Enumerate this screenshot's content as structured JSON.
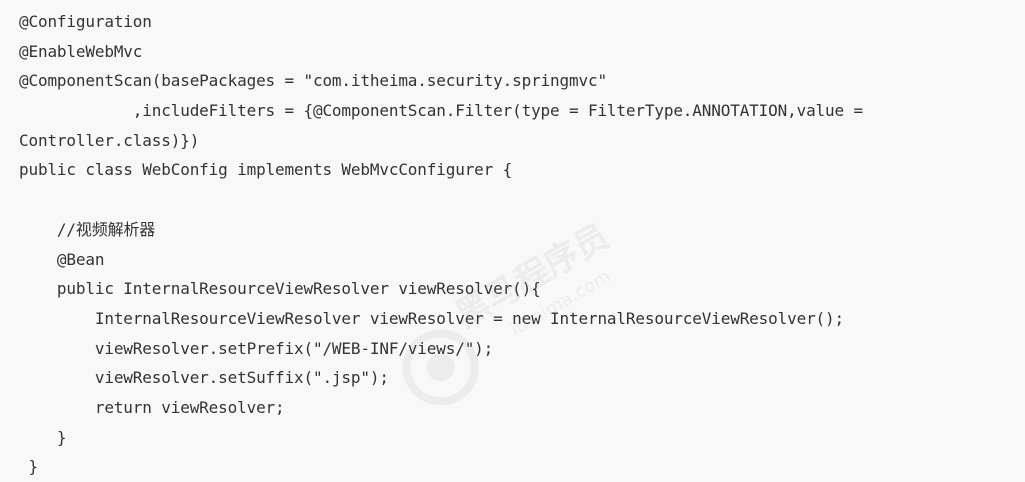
{
  "code": {
    "lines": [
      "@Configuration",
      "@EnableWebMvc",
      "@ComponentScan(basePackages = \"com.itheima.security.springmvc\"",
      "            ,includeFilters = {@ComponentScan.Filter(type = FilterType.ANNOTATION,value =",
      "Controller.class)})",
      "public class WebConfig implements WebMvcConfigurer {",
      "",
      "    //视频解析器",
      "    @Bean",
      "    public InternalResourceViewResolver viewResolver(){",
      "        InternalResourceViewResolver viewResolver = new InternalResourceViewResolver();",
      "        viewResolver.setPrefix(\"/WEB-INF/views/\");",
      "        viewResolver.setSuffix(\".jsp\");",
      "        return viewResolver;",
      "    }",
      " }"
    ]
  },
  "watermark": {
    "brand_text": "黑马程序员",
    "domain_text": "itheima.com",
    "color": "#8a8a8a"
  },
  "colors": {
    "background": "#f8f8f8",
    "text": "#333333"
  }
}
